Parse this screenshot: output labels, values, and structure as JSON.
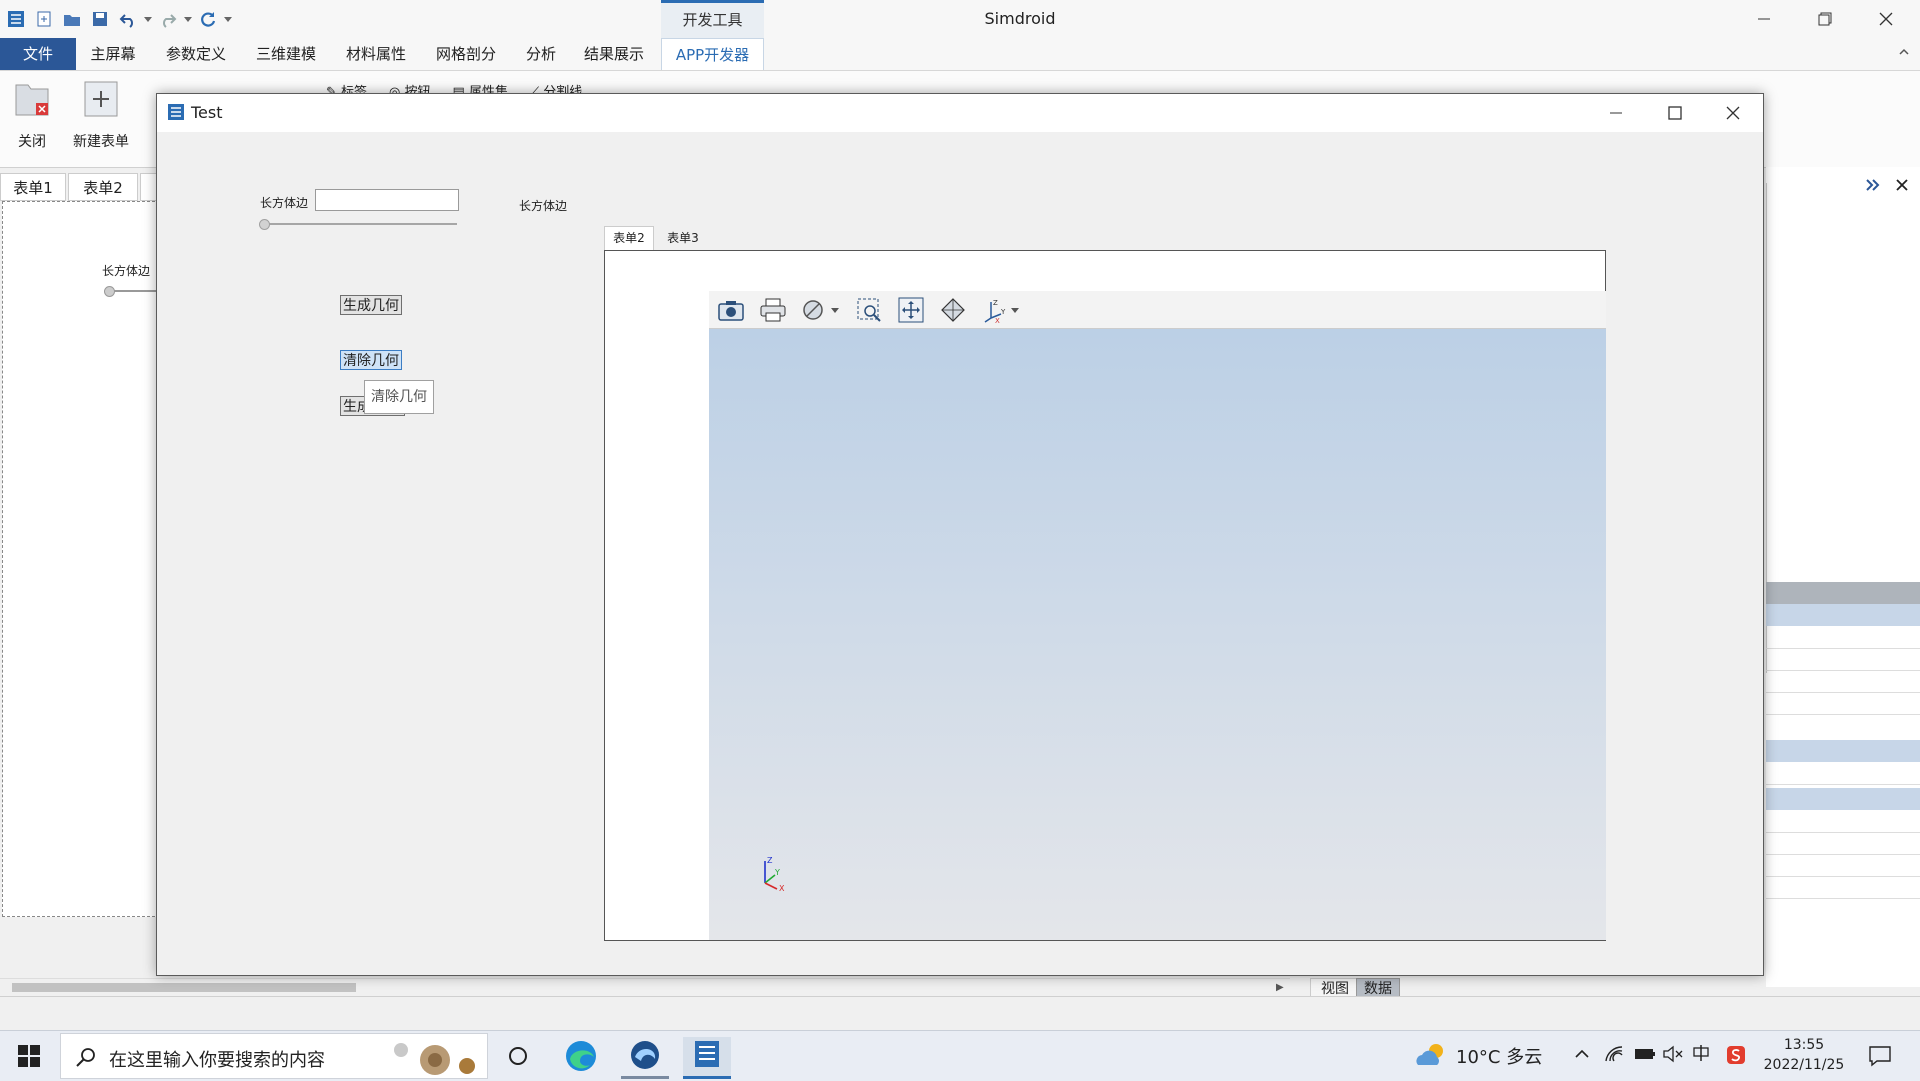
{
  "app": {
    "title": "Simdroid",
    "context_tab": "开发工具"
  },
  "ribbon": {
    "tabs": [
      "文件",
      "主屏幕",
      "参数定义",
      "三维建模",
      "材料属性",
      "网格剖分",
      "分析",
      "结果展示",
      "APP开发器"
    ],
    "buttons": {
      "close": "关闭",
      "new_form": "新建表单",
      "label": "标签",
      "button": "按钮",
      "property_set": "属性集",
      "divider": "分割线"
    }
  },
  "designer": {
    "tabs": [
      "表单1",
      "表单2"
    ],
    "label": "长方体边"
  },
  "dialog": {
    "title": "Test",
    "field_label": "长方体边",
    "field_value": "",
    "field_label_right": "长方体边",
    "generate_button": "生成几何",
    "clear_button": "清除几何",
    "third_button_partial": "生成",
    "tooltip": "清除几何",
    "viewer_tabs": [
      "表单2",
      "表单3"
    ],
    "axis": {
      "x": "X",
      "y": "Y",
      "z": "Z"
    }
  },
  "bottom": {
    "tab_view": "视图",
    "tab_data": "数据"
  },
  "taskbar": {
    "search_placeholder": "在这里输入你要搜索的内容",
    "weather": "10°C 多云",
    "time": "13:55",
    "date": "2022/11/25"
  },
  "colors": {
    "brand_blue": "#2b5797",
    "accent_blue": "#2b6cb3",
    "viewport_top": "#bcd0e6",
    "viewport_bottom": "#e4e6ea"
  }
}
